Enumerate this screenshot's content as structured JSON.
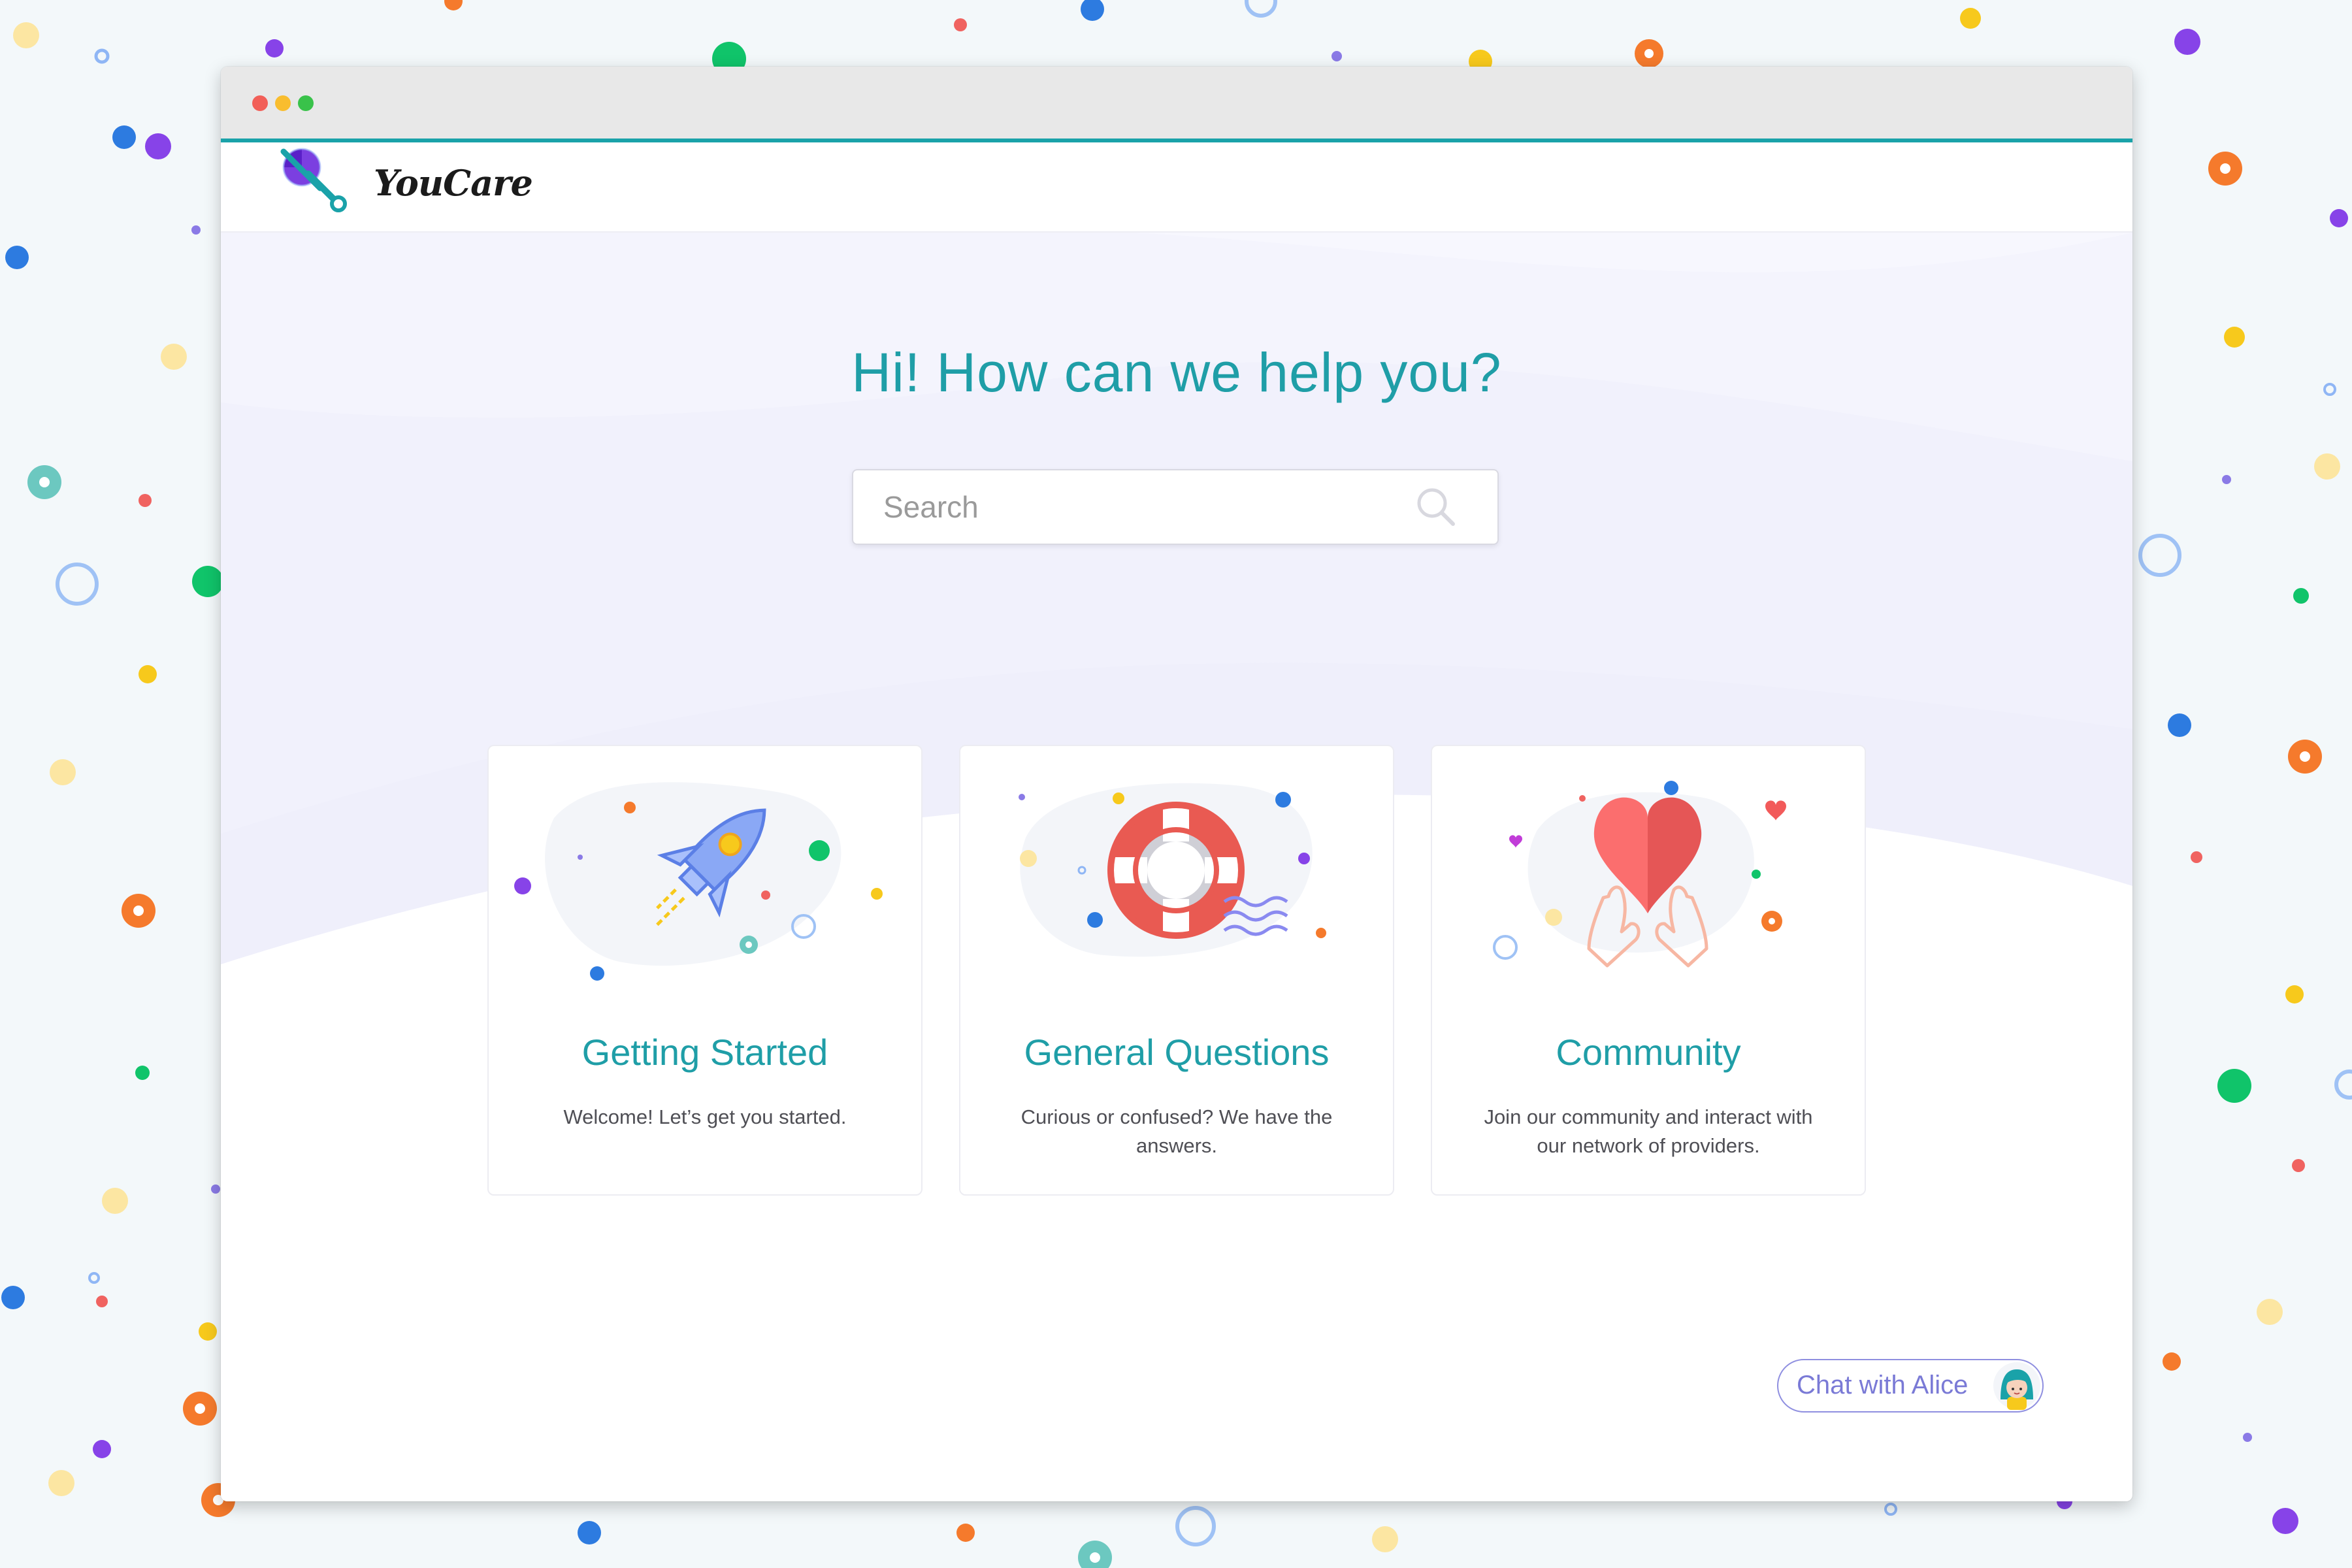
{
  "window": {
    "controls": [
      "close",
      "minimize",
      "maximize"
    ]
  },
  "brand": {
    "name": "YouCare",
    "logo_icon": "magnifier-logo-icon"
  },
  "hero": {
    "title": "Hi! How can we help you?"
  },
  "search": {
    "placeholder": "Search",
    "value": "",
    "icon": "search-icon"
  },
  "cards": [
    {
      "title": "Getting Started",
      "description": "Welcome! Let’s get you started.",
      "icon": "rocket-icon"
    },
    {
      "title": "General Questions",
      "description": "Curious or confused? We have the answers.",
      "icon": "lifebuoy-icon"
    },
    {
      "title": "Community",
      "description": "Join our community and interact with our network of providers.",
      "icon": "heart-hands-icon"
    }
  ],
  "chat": {
    "label": "Chat with Alice",
    "avatar": "alice-avatar"
  },
  "colors": {
    "accent_teal": "#1f9ea7",
    "chat_purple": "#7a7ad6",
    "hero_wash": "#efeffb",
    "heart_red": "#f25a5a",
    "rocket_blue": "#8aa8f5"
  }
}
